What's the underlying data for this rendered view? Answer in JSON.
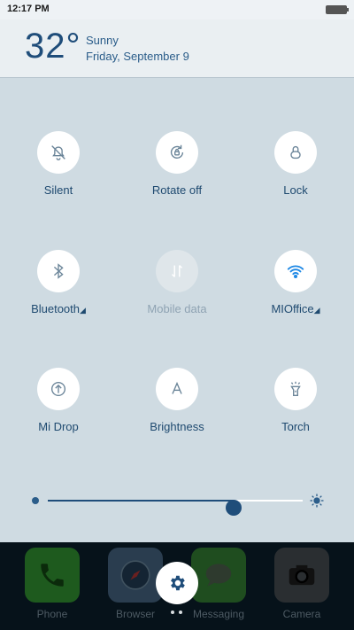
{
  "status": {
    "time": "12:17 PM"
  },
  "weather": {
    "temperature": "32°",
    "condition": "Sunny",
    "date": "Friday, September 9"
  },
  "toggles": [
    {
      "label": "Silent",
      "icon": "bell-off-icon"
    },
    {
      "label": "Rotate off",
      "icon": "rotate-lock-icon"
    },
    {
      "label": "Lock",
      "icon": "lock-icon"
    },
    {
      "label": "Bluetooth",
      "icon": "bluetooth-icon"
    },
    {
      "label": "Mobile data",
      "icon": "mobile-data-icon",
      "disabled": true
    },
    {
      "label": "MIOffice",
      "icon": "wifi-icon",
      "active": true
    },
    {
      "label": "Mi Drop",
      "icon": "mi-drop-icon"
    },
    {
      "label": "Brightness",
      "icon": "auto-brightness-icon"
    },
    {
      "label": "Torch",
      "icon": "torch-icon"
    }
  ],
  "brightness": {
    "level": 0.73
  },
  "dock": [
    {
      "label": "Phone",
      "icon": "phone-icon",
      "color": "#1e5a1e"
    },
    {
      "label": "Browser",
      "icon": "compass-icon",
      "color": "#2a3d4f"
    },
    {
      "label": "Messaging",
      "icon": "message-icon",
      "color": "#1f4d1f"
    },
    {
      "label": "Camera",
      "icon": "camera-icon",
      "color": "#2a2e31"
    }
  ],
  "colors": {
    "accent": "#1f4d7a",
    "panel": "#cfdbe2"
  }
}
